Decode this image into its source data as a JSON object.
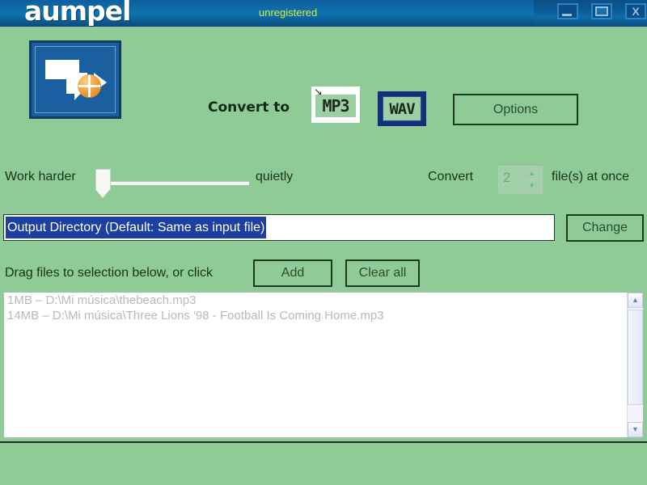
{
  "titlebar": {
    "app_title": "aumpel",
    "status": "unregistered",
    "minimize_label": "",
    "maximize_label": "",
    "close_label": "X"
  },
  "toolbar": {
    "convert_to_label": "Convert to",
    "mp3_label": "MP3",
    "mp3_cursor": "↘",
    "wav_label": "WAV",
    "options_label": "Options"
  },
  "slider": {
    "left_label": "Work harder",
    "right_label": "quietly",
    "value": 0
  },
  "spinner": {
    "prefix_label": "Convert",
    "value": "2",
    "up_arrow": "▲",
    "down_arrow": "▼",
    "suffix_label": "file(s) at once"
  },
  "output_directory": {
    "value": "Output Directory (Default: Same as input file)",
    "placeholder": "Output Directory (Default: Same as input file)",
    "change_label": "Change"
  },
  "files_section": {
    "drag_label": "Drag files to selection below, or click",
    "add_label": "Add",
    "clear_all_label": "Clear all",
    "rows": [
      "1MB – D:\\Mi música\\thebeach.mp3",
      "14MB – D:\\Mi música\\Three Lions '98 - Football Is Coming Home.mp3"
    ],
    "scroll_up": "▲",
    "scroll_down": "▼"
  },
  "colors": {
    "window_background": "#8fcb97",
    "titlebar": "#0b4f86",
    "accent_blue": "#1a5fa0",
    "selection_blue": "#1c3fa0",
    "status_yellow": "#d9e83a",
    "logo_orange": "#f3a23c"
  }
}
